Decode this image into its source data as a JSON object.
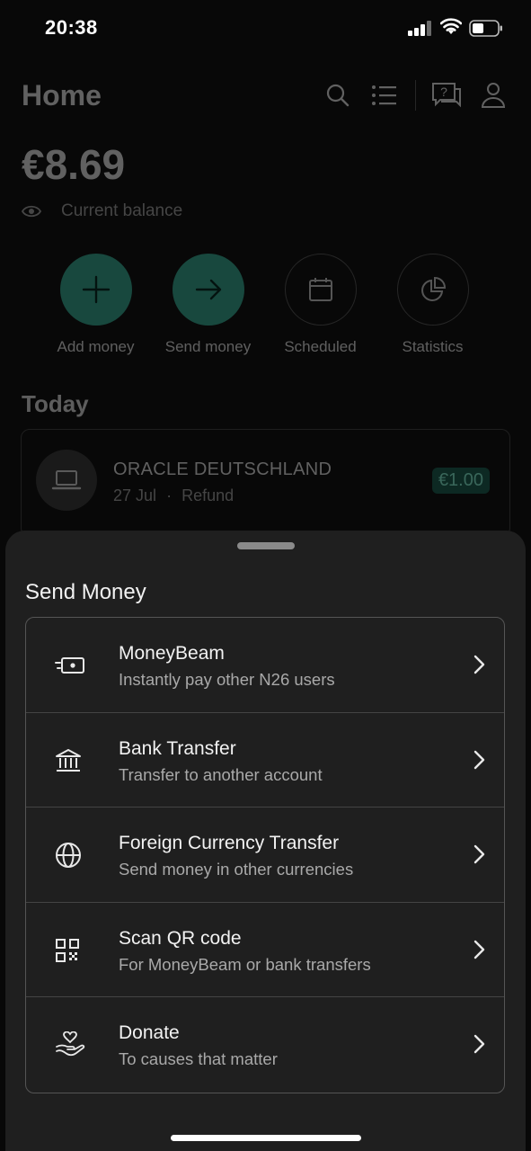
{
  "status_bar": {
    "time": "20:38"
  },
  "header": {
    "title": "Home"
  },
  "balance": {
    "amount": "€8.69",
    "label": "Current balance"
  },
  "actions": [
    {
      "label": "Add money",
      "icon": "plus-icon"
    },
    {
      "label": "Send money",
      "icon": "arrow-right-icon"
    },
    {
      "label": "Scheduled",
      "icon": "calendar-icon"
    },
    {
      "label": "Statistics",
      "icon": "pie-chart-icon"
    }
  ],
  "today": {
    "title": "Today",
    "transaction": {
      "name": "ORACLE DEUTSCHLAND",
      "date": "27 Jul",
      "separator": "·",
      "type": "Refund",
      "amount": "€1.00"
    }
  },
  "sheet": {
    "title": "Send Money",
    "items": [
      {
        "label": "MoneyBeam",
        "sub": "Instantly pay other N26 users",
        "icon": "moneybeam-icon"
      },
      {
        "label": "Bank Transfer",
        "sub": "Transfer to another account",
        "icon": "bank-icon"
      },
      {
        "label": "Foreign Currency Transfer",
        "sub": "Send money in other currencies",
        "icon": "globe-icon"
      },
      {
        "label": "Scan QR code",
        "sub": "For MoneyBeam or bank transfers",
        "icon": "qr-code-icon"
      },
      {
        "label": "Donate",
        "sub": "To causes that matter",
        "icon": "donate-heart-icon"
      }
    ]
  },
  "colors": {
    "accent": "#36a18b",
    "amount_bg": "#1e5c4f",
    "amount_text": "#7fe3c7"
  }
}
